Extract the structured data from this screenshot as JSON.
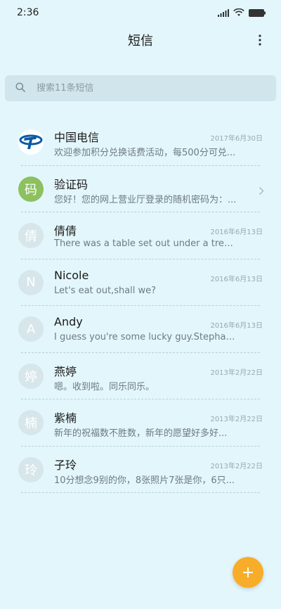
{
  "status_bar": {
    "time": "2:36"
  },
  "header": {
    "title": "短信",
    "more_icon": "more-vertical-icon"
  },
  "search": {
    "placeholder": "搜索11条短信",
    "icon": "search-icon"
  },
  "conversations": [
    {
      "name": "中国电信",
      "preview": "欢迎参加积分兑换话费活动，每500分可兑...",
      "date": "2017年6月30日",
      "avatar_type": "logo",
      "avatar_text": ""
    },
    {
      "name": "验证码",
      "preview": "您好！您的网上营业厅登录的随机密码为：...",
      "date": "",
      "avatar_type": "green",
      "avatar_text": "码"
    },
    {
      "name": "倩倩",
      "preview": "There was a table set out under a tree in...",
      "date": "2016年6月13日",
      "avatar_type": "letter",
      "avatar_text": "倩"
    },
    {
      "name": "Nicole",
      "preview": "Let's eat out,shall we?",
      "date": "2016年6月13日",
      "avatar_type": "letter",
      "avatar_text": "N"
    },
    {
      "name": "Andy",
      "preview": "I guess you're some lucky guy.Stephani...",
      "date": "2016年6月13日",
      "avatar_type": "letter",
      "avatar_text": "A"
    },
    {
      "name": "燕婷",
      "preview": "嗯。收到啦。同乐同乐。",
      "date": "2013年2月22日",
      "avatar_type": "letter",
      "avatar_text": "婷"
    },
    {
      "name": "紫楠",
      "preview": "新年的祝福数不胜数，新年的愿望好多好...",
      "date": "2013年2月22日",
      "avatar_type": "letter",
      "avatar_text": "楠"
    },
    {
      "name": "子玲",
      "preview": "10分想念9别的你，8张照片7张是你，6只...",
      "date": "2013年2月22日",
      "avatar_type": "letter",
      "avatar_text": "玲"
    }
  ],
  "fab": {
    "label": "+",
    "color": "#f8ad2a"
  },
  "colors": {
    "background": "#e3f6fb",
    "avatar_default": "#d7e6ea",
    "avatar_green": "#8dc05f",
    "brand_telecom": "#0a5aa8"
  }
}
